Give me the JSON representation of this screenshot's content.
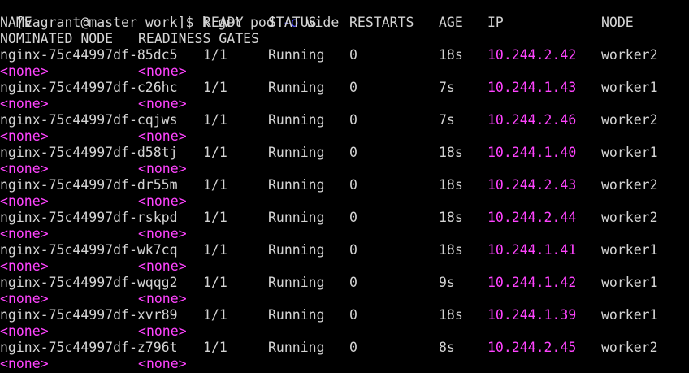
{
  "prompt": {
    "text": "[vagrant@master work]$ ",
    "command": "k get pod ",
    "option": "-o",
    "arg": " wide"
  },
  "headers": {
    "name": "NAME",
    "ready": "READY",
    "status": "STATUS",
    "restarts": "RESTARTS",
    "age": "AGE",
    "ip": "IP",
    "node": "NODE",
    "nominated_node": "NOMINATED NODE",
    "readiness_gates": "READINESS GATES"
  },
  "pods": [
    {
      "name": "nginx-75c44997df-85dc5",
      "ready": "1/1",
      "status": "Running",
      "restarts": "0",
      "age": "18s",
      "ip": "10.244.2.42",
      "node": "worker2",
      "nominated_node": "none",
      "readiness_gates": "none"
    },
    {
      "name": "nginx-75c44997df-c26hc",
      "ready": "1/1",
      "status": "Running",
      "restarts": "0",
      "age": "7s",
      "ip": "10.244.1.43",
      "node": "worker1",
      "nominated_node": "none",
      "readiness_gates": "none"
    },
    {
      "name": "nginx-75c44997df-cqjws",
      "ready": "1/1",
      "status": "Running",
      "restarts": "0",
      "age": "7s",
      "ip": "10.244.2.46",
      "node": "worker2",
      "nominated_node": "none",
      "readiness_gates": "none"
    },
    {
      "name": "nginx-75c44997df-d58tj",
      "ready": "1/1",
      "status": "Running",
      "restarts": "0",
      "age": "18s",
      "ip": "10.244.1.40",
      "node": "worker1",
      "nominated_node": "none",
      "readiness_gates": "none"
    },
    {
      "name": "nginx-75c44997df-dr55m",
      "ready": "1/1",
      "status": "Running",
      "restarts": "0",
      "age": "18s",
      "ip": "10.244.2.43",
      "node": "worker2",
      "nominated_node": "none",
      "readiness_gates": "none"
    },
    {
      "name": "nginx-75c44997df-rskpd",
      "ready": "1/1",
      "status": "Running",
      "restarts": "0",
      "age": "18s",
      "ip": "10.244.2.44",
      "node": "worker2",
      "nominated_node": "none",
      "readiness_gates": "none"
    },
    {
      "name": "nginx-75c44997df-wk7cq",
      "ready": "1/1",
      "status": "Running",
      "restarts": "0",
      "age": "18s",
      "ip": "10.244.1.41",
      "node": "worker1",
      "nominated_node": "none",
      "readiness_gates": "none"
    },
    {
      "name": "nginx-75c44997df-wqqg2",
      "ready": "1/1",
      "status": "Running",
      "restarts": "0",
      "age": "9s",
      "ip": "10.244.1.42",
      "node": "worker1",
      "nominated_node": "none",
      "readiness_gates": "none"
    },
    {
      "name": "nginx-75c44997df-xvr89",
      "ready": "1/1",
      "status": "Running",
      "restarts": "0",
      "age": "18s",
      "ip": "10.244.1.39",
      "node": "worker1",
      "nominated_node": "none",
      "readiness_gates": "none"
    },
    {
      "name": "nginx-75c44997df-z796t",
      "ready": "1/1",
      "status": "Running",
      "restarts": "0",
      "age": "8s",
      "ip": "10.244.2.45",
      "node": "worker2",
      "nominated_node": "none",
      "readiness_gates": "none"
    }
  ],
  "colors": {
    "background": "#000000",
    "text": "#d4d4d4",
    "ip": "#ff44ff",
    "none_tag": "#ff44ff",
    "option_flag": "#5c5cff"
  }
}
